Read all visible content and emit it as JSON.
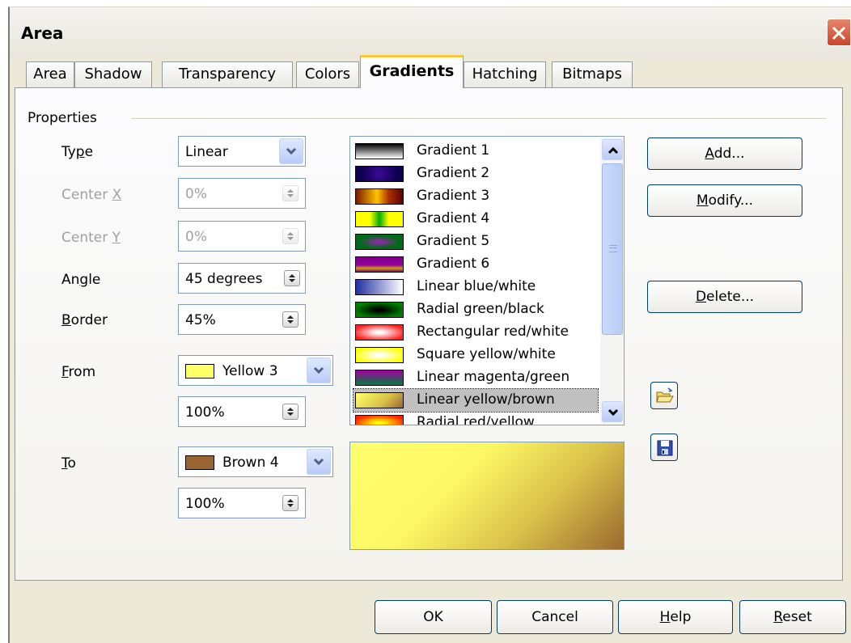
{
  "dialog": {
    "title": "Area"
  },
  "tabs": [
    {
      "label": "Area"
    },
    {
      "label": "Shadow"
    },
    {
      "label": "Transparency"
    },
    {
      "label": "Colors"
    },
    {
      "label": "Gradients"
    },
    {
      "label": "Hatching"
    },
    {
      "label": "Bitmaps"
    }
  ],
  "active_tab": "Gradients",
  "properties": {
    "group_label": "Properties",
    "type": {
      "label_pre": "Ty",
      "label_key": "p",
      "label_post": "e",
      "value": "Linear"
    },
    "center_x": {
      "label_pre": "Center ",
      "label_key": "X",
      "value": "0%",
      "disabled": true
    },
    "center_y": {
      "label_pre": "Center ",
      "label_key": "Y",
      "value": "0%",
      "disabled": true
    },
    "angle": {
      "label_pre": "An",
      "label_key": "g",
      "label_post": "le",
      "value": "45 degrees"
    },
    "border": {
      "label_key": "B",
      "label_post": "order",
      "value": "45%"
    },
    "from": {
      "label_key": "F",
      "label_post": "rom",
      "color_name": "Yellow 3",
      "color": "#ffff66",
      "intensity": "100%"
    },
    "to": {
      "label_key": "T",
      "label_post": "o",
      "color_name": "Brown 4",
      "color": "#996633",
      "intensity": "100%"
    }
  },
  "gradient_list": {
    "items": [
      {
        "name": "Gradient 1",
        "preview": "linear-gradient(180deg,#000000,#ffffff)"
      },
      {
        "name": "Gradient 2",
        "preview": "radial-gradient(circle at 50% 50%,#3a0a9a,#100050 70%)"
      },
      {
        "name": "Gradient 3",
        "preview": "linear-gradient(90deg,#7a1a00,#ffc400 45%,#a83000 70%,#5a0000)"
      },
      {
        "name": "Gradient 4",
        "preview": "linear-gradient(90deg,#ffff00,#ffff00 30%,#00b000 50%,#ffff00 70%,#ffff00)"
      },
      {
        "name": "Gradient 5",
        "preview": "radial-gradient(ellipse at 50% 50%,#8a2aa0 10%,#006a18 60%)"
      },
      {
        "name": "Gradient 6",
        "preview": "linear-gradient(180deg,#7a0088,#9a00a0 55%,#c8a800 75%,#8a0090)"
      },
      {
        "name": "Linear blue/white",
        "preview": "linear-gradient(90deg,#2030a0,#ffffff)"
      },
      {
        "name": "Radial green/black",
        "preview": "radial-gradient(ellipse at 50% 50%,#000000 10%,#008000 75%)"
      },
      {
        "name": "Rectangular red/white",
        "preview": "radial-gradient(ellipse at 50% 50%,#ffffff 10%,#ff2020 80%)"
      },
      {
        "name": "Square yellow/white",
        "preview": "radial-gradient(ellipse at 50% 50%,#ffffff 10%,#ffff00 80%)"
      },
      {
        "name": "Linear magenta/green",
        "preview": "linear-gradient(180deg,#a000a0,#008040)"
      },
      {
        "name": "Linear yellow/brown",
        "preview": "linear-gradient(135deg,#ffff66,#d9c14a 60%,#996633)"
      },
      {
        "name": "Radial red/yellow",
        "preview": "radial-gradient(ellipse at 50% 50%,#ffff00 10%,#ff2000 80%)"
      }
    ],
    "selected": "Linear yellow/brown"
  },
  "actions": {
    "add": {
      "key": "A",
      "rest": "dd..."
    },
    "modify": {
      "key": "M",
      "rest": "odify..."
    },
    "delete": {
      "key": "D",
      "rest": "elete..."
    }
  },
  "footer": {
    "ok": "OK",
    "cancel": "Cancel",
    "help": {
      "key": "H",
      "rest": "elp"
    },
    "reset": {
      "key": "R",
      "rest": "eset"
    }
  },
  "colors": {
    "accent_tab": "#ffc83c",
    "button_border": "#003c74",
    "field_border": "#7f9db9"
  },
  "icons": [
    "close-icon",
    "chevron-down-icon",
    "spin-arrows-icon",
    "scroll-up-icon",
    "scroll-down-icon",
    "open-folder-icon",
    "save-disk-icon"
  ]
}
